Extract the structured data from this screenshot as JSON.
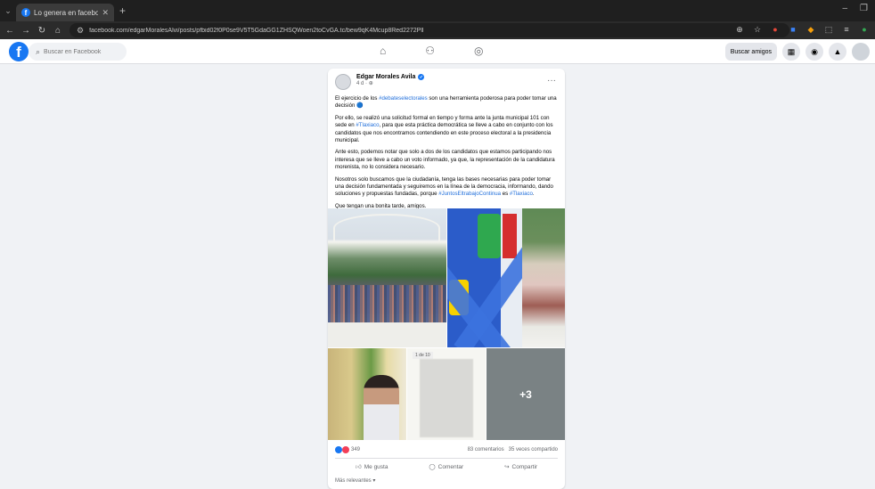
{
  "browser": {
    "tab_title": "Lo genera en facebook/edo...",
    "new_tab": "+",
    "url": "facebook.com/edgarMoralesAlvi/posts/pfbid02f0P0se9V5T5GdaGG1ZHSQWoen2toCvGA.tc/bew9qK4Mcup8Red2272Pll",
    "window_controls": [
      "–",
      "❐"
    ]
  },
  "facebook": {
    "search_placeholder": "Buscar en Facebook",
    "find_friends": "Buscar amigos"
  },
  "post": {
    "author": "Edgar Morales Avila",
    "meta": "4 d · ",
    "paragraphs": [
      {
        "pre": "El ejercicio de los ",
        "tag": "#debateselectorales",
        "post": " son una herramienta poderosa para poder tomar una decisión 🔵"
      },
      {
        "pre": "Por ello, se realizó una solicitud formal en tiempo y forma ante la junta municipal 101 con sede en ",
        "tag": "#Tlaxiaco",
        "post": ", para que esta práctica democrática se lleve a cabo en conjunto con los candidatos que nos encontramos contendiendo en este proceso electoral a la presidencia municipal."
      },
      {
        "pre": "Ante esto, podemos notar que solo a dos de los candidatos que estamos participando nos interesa que se lleve a cabo un voto informado, ya que, la representación de la candidatura morenista, no lo considera necesario.",
        "tag": "",
        "post": ""
      },
      {
        "pre": "Nosotros solo buscamos que la ciudadanía, tenga las bases necesarias para poder tomar una decisión fundamentada y seguiremos en la línea de la democracia, informando, dando soluciones y propuestas fundadas, porque ",
        "tag": "#JuntosEltrabajoContinua",
        "post": " es ",
        "tag2": "#Tlaxiaco",
        "post2": "."
      },
      {
        "pre": "Que tengan una bonita tarde, amigos.",
        "tag": "",
        "post": ""
      }
    ],
    "photo_chip": "1 de 10",
    "more_photos": "+3",
    "reactions_count": "349",
    "comments": "83 comentarios",
    "shares": "35 veces compartido",
    "action_like": "Me gusta",
    "action_comment": "Comentar",
    "action_share": "Compartir",
    "sort": "Más relevantes ▾"
  },
  "colors": {
    "facebook_blue": "#1877f2",
    "hashtag": "#216fdb"
  }
}
